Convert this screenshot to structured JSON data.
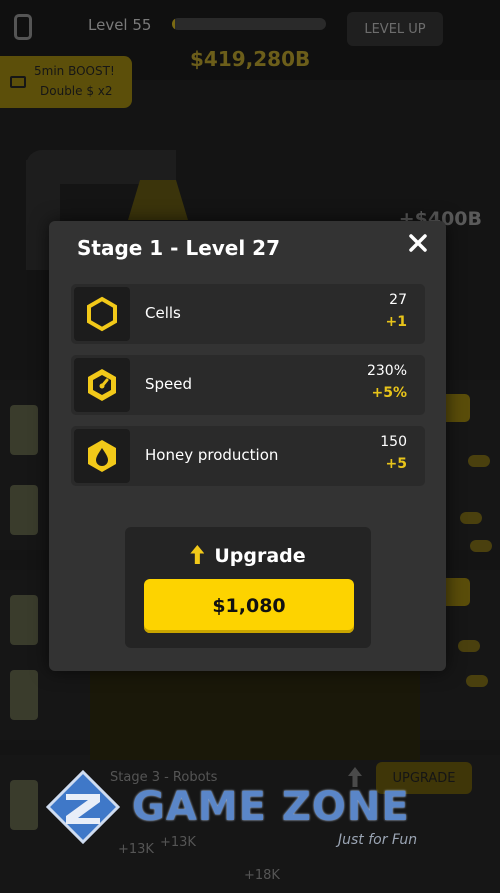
{
  "hud": {
    "level_label": "Level 55",
    "level_progress": 0.02,
    "level_up_label": "LEVEL UP",
    "money": "$419,280B",
    "boost_line1": "5min BOOST!",
    "boost_line2": "Double $ x2"
  },
  "background": {
    "right_amount_1": "+$400B",
    "stage3_label": "Stage 3 - Robots",
    "upgrade_label": "UPGRADE",
    "amount_a": "+13K",
    "amount_b": "+13K",
    "amount_c": "+18K"
  },
  "modal": {
    "title": "Stage 1 - Level 27",
    "stats": [
      {
        "name": "Cells",
        "value": "27",
        "increment": "+1",
        "icon": "hexagon-cell-icon"
      },
      {
        "name": "Speed",
        "value": "230%",
        "increment": "+5%",
        "icon": "speedometer-icon"
      },
      {
        "name": "Honey production",
        "value": "150",
        "increment": "+5",
        "icon": "honey-drop-icon"
      }
    ],
    "upgrade_title": "Upgrade",
    "upgrade_price": "$1,080"
  },
  "watermark": {
    "brand": "GAME ZONE",
    "tagline": "Just for Fun"
  },
  "colors": {
    "accent_yellow": "#fdd300",
    "modal_bg": "#333333",
    "increment_yellow": "#e8c41a"
  }
}
